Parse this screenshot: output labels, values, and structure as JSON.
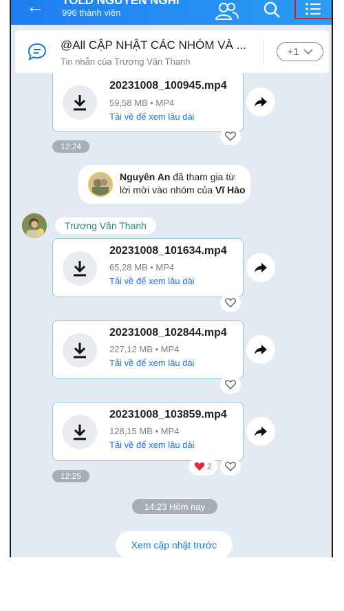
{
  "header": {
    "title": "TOLD NGUYEN NGHI",
    "subtitle": "996 thành viên"
  },
  "pinned": {
    "title": "@All CẬP NHẬT CÁC NHÓM VÀ ...",
    "subtitle": "Tin nhắn của Trương Văn Thanh",
    "more_label": "+1"
  },
  "messages": {
    "file0": {
      "name": "20231008_100945.mp4",
      "meta": "59,58 MB • MP4",
      "link": "Tải về để xem lâu dài"
    },
    "time0": "12:24",
    "system": {
      "name": "Nguyên An",
      "mid": " đã tham gia từ lời mời vào nhóm của ",
      "inviter": "Vĩ Hào"
    },
    "sender": "Trương Văn Thanh",
    "file1": {
      "name": "20231008_101634.mp4",
      "meta": "65,28 MB • MP4",
      "link": "Tải về để xem lâu dài"
    },
    "file2": {
      "name": "20231008_102844.mp4",
      "meta": "227,12 MB • MP4",
      "link": "Tải về để xem lâu dài"
    },
    "file3": {
      "name": "20231008_103859.mp4",
      "meta": "128,15 MB • MP4",
      "link": "Tải về để xem lâu dài",
      "reaction_count": "2"
    },
    "time1": "12:25",
    "today_divider": "14:23 Hôm nay",
    "older_updates": "Xem cập nhật trước"
  },
  "colors": {
    "header": "#1e7ef0",
    "link": "#1a73e8",
    "card_border": "#8fcbd9",
    "highlight": "#d81f2a",
    "background": "#e3eaf3"
  }
}
